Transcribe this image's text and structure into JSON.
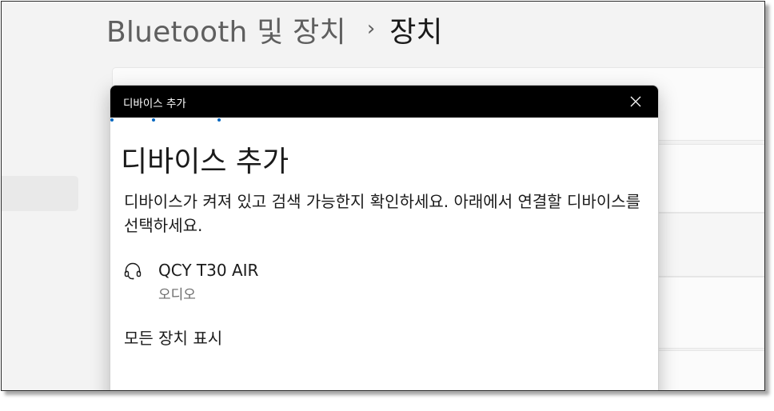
{
  "header": {
    "breadcrumb_parent": "Bluetooth 및 장치",
    "breadcrumb_separator": "›",
    "breadcrumb_current": "장치"
  },
  "dialog": {
    "title": "디바이스 추가",
    "heading": "디바이스 추가",
    "description": "디바이스가 켜져 있고 검색 가능한지 확인하세요. 아래에서 연결할 디바이스를 선택하세요.",
    "close_icon": "close-icon",
    "devices": [
      {
        "name": "QCY T30 AIR",
        "type": "오디오",
        "icon": "headset-icon"
      }
    ],
    "show_all_label": "모든 장치 표시"
  },
  "colors": {
    "accent": "#0067c0",
    "titlebar": "#000000",
    "background": "#f3f3f3",
    "dialog_bg": "#ffffff",
    "secondary_text": "#6b6b6b"
  }
}
